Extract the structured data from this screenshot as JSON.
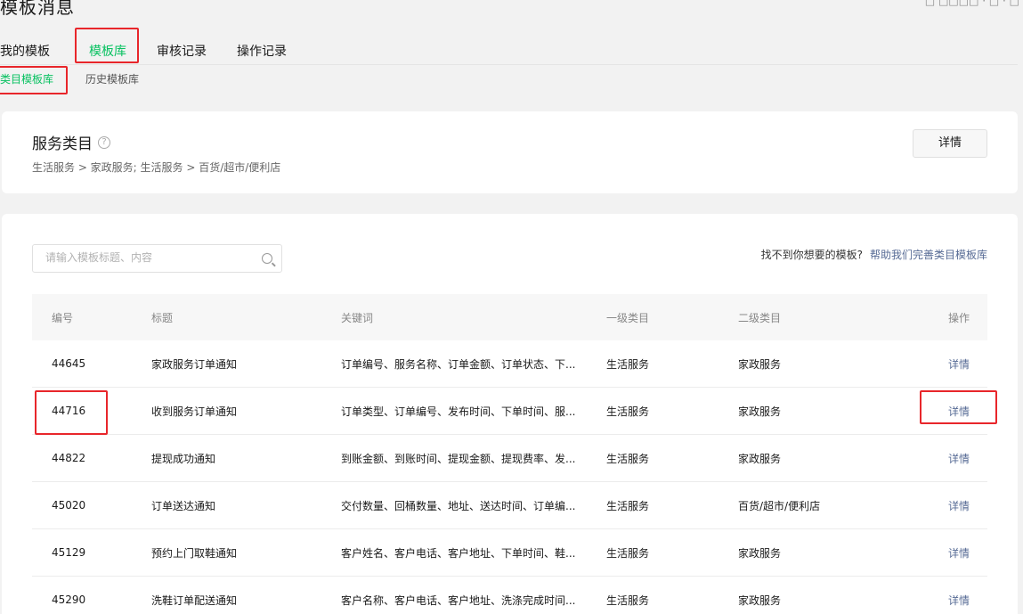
{
  "page": {
    "title": "模板消息",
    "top_right": "□ □□□□ · □ · □"
  },
  "tabs": [
    {
      "label": "我的模板"
    },
    {
      "label": "模板库"
    },
    {
      "label": "审核记录"
    },
    {
      "label": "操作记录"
    }
  ],
  "subtabs": [
    {
      "label": "类目模板库"
    },
    {
      "label": "历史模板库"
    }
  ],
  "service": {
    "title": "服务类目",
    "help_icon": "?",
    "breadcrumb": "生活服务 > 家政服务; 生活服务 > 百货/超市/便利店",
    "detail_label": "详情"
  },
  "list": {
    "search_placeholder": "请输入模板标题、内容",
    "hint_text": "找不到你想要的模板?",
    "hint_link": "帮助我们完善类目模板库",
    "columns": [
      "编号",
      "标题",
      "关键词",
      "一级类目",
      "二级类目",
      "操作"
    ],
    "rows": [
      {
        "id": "44645",
        "title": "家政服务订单通知",
        "keywords": "订单编号、服务名称、订单金额、订单状态、下...",
        "cat1": "生活服务",
        "cat2": "家政服务",
        "action": "详情"
      },
      {
        "id": "44716",
        "title": "收到服务订单通知",
        "keywords": "订单类型、订单编号、发布时间、下单时间、服...",
        "cat1": "生活服务",
        "cat2": "家政服务",
        "action": "详情"
      },
      {
        "id": "44822",
        "title": "提现成功通知",
        "keywords": "到账金额、到账时间、提现金额、提现费率、发...",
        "cat1": "生活服务",
        "cat2": "家政服务",
        "action": "详情"
      },
      {
        "id": "45020",
        "title": "订单送达通知",
        "keywords": "交付数量、回桶数量、地址、送达时间、订单编...",
        "cat1": "生活服务",
        "cat2": "百货/超市/便利店",
        "action": "详情"
      },
      {
        "id": "45129",
        "title": "预约上门取鞋通知",
        "keywords": "客户姓名、客户电话、客户地址、下单时间、鞋...",
        "cat1": "生活服务",
        "cat2": "家政服务",
        "action": "详情"
      },
      {
        "id": "45290",
        "title": "洗鞋订单配送通知",
        "keywords": "客户名称、客户电话、客户地址、洗涤完成时间...",
        "cat1": "生活服务",
        "cat2": "家政服务",
        "action": "详情"
      }
    ]
  },
  "colors": {
    "accent_green": "#07c160",
    "link_blue": "#576b95",
    "highlight_red": "#e8262b"
  }
}
